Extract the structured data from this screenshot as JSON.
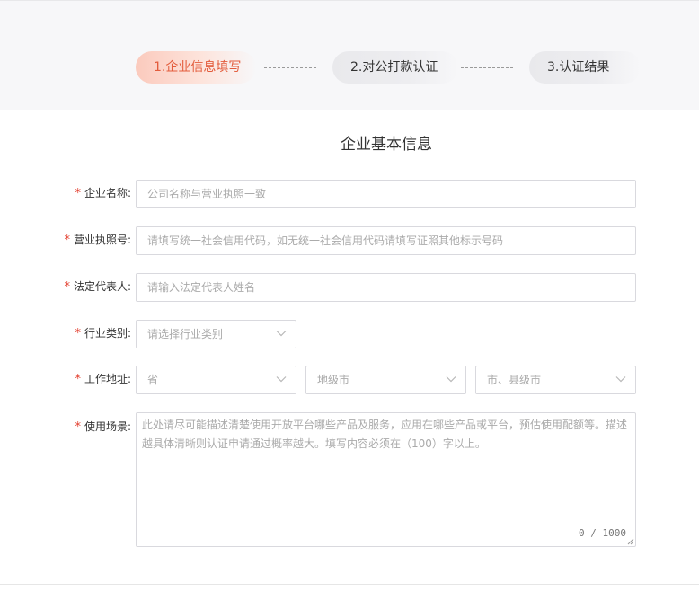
{
  "steps": [
    {
      "label": "1.企业信息填写"
    },
    {
      "label": "2.对公打款认证"
    },
    {
      "label": "3.认证结果"
    }
  ],
  "form": {
    "title": "企业基本信息",
    "required_mark": "*",
    "company_name": {
      "label": "企业名称:",
      "placeholder": "公司名称与营业执照一致"
    },
    "license_no": {
      "label": "营业执照号:",
      "placeholder": "请填写统一社会信用代码，如无统一社会信用代码请填写证照其他标示号码"
    },
    "legal_rep": {
      "label": "法定代表人:",
      "placeholder": "请输入法定代表人姓名"
    },
    "industry": {
      "label": "行业类别:",
      "placeholder": "请选择行业类别"
    },
    "address": {
      "label": "工作地址:",
      "province": "省",
      "city": "地级市",
      "county": "市、县级市"
    },
    "scenario": {
      "label": "使用场景:",
      "placeholder": "此处请尽可能描述清楚使用开放平台哪些产品及服务，应用在哪些产品或平台，预估使用配额等。描述越具体清晰则认证申请通过概率越大。填写内容必须在（100）字以上。",
      "counter": "0 / 1000"
    }
  },
  "colors": {
    "accent": "#e35c3c",
    "required": "#e23b2a"
  }
}
